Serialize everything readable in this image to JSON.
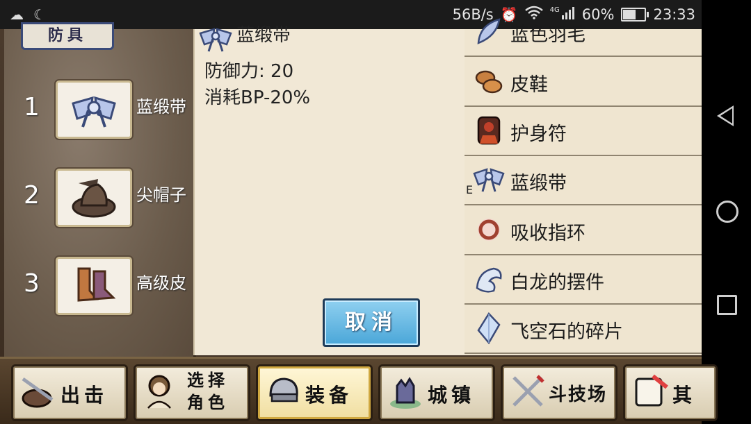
{
  "status_bar": {
    "speed": "56B/s",
    "network": "4G",
    "battery": "60%",
    "time": "23:33"
  },
  "left_panel": {
    "section_title": "防具",
    "slots": [
      {
        "number": "1",
        "label": "蓝缎带"
      },
      {
        "number": "2",
        "label": "尖帽子"
      },
      {
        "number": "3",
        "label": "高级皮"
      }
    ]
  },
  "detail": {
    "item_name": "蓝缎带",
    "stat_defense": "防御力: 20",
    "stat_bp": "消耗BP-20%",
    "cancel_label": "取消"
  },
  "item_list": {
    "items": [
      {
        "label": "蓝色羽毛",
        "icon": "feather-icon"
      },
      {
        "label": "皮鞋",
        "icon": "shoes-icon"
      },
      {
        "label": "护身符",
        "icon": "amulet-icon"
      },
      {
        "label": "蓝缎带",
        "icon": "ribbon-icon",
        "equipped_mark": "E"
      },
      {
        "label": "吸收指环",
        "icon": "ring-icon"
      },
      {
        "label": "白龙的摆件",
        "icon": "dragon-icon"
      },
      {
        "label": "飞空石的碎片",
        "icon": "crystal-icon"
      }
    ]
  },
  "tabs": {
    "sortie": "出击",
    "select_role_1": "选择",
    "select_role_2": "角色",
    "equip": "装备",
    "town": "城镇",
    "arena": "斗技场",
    "other": "其"
  }
}
